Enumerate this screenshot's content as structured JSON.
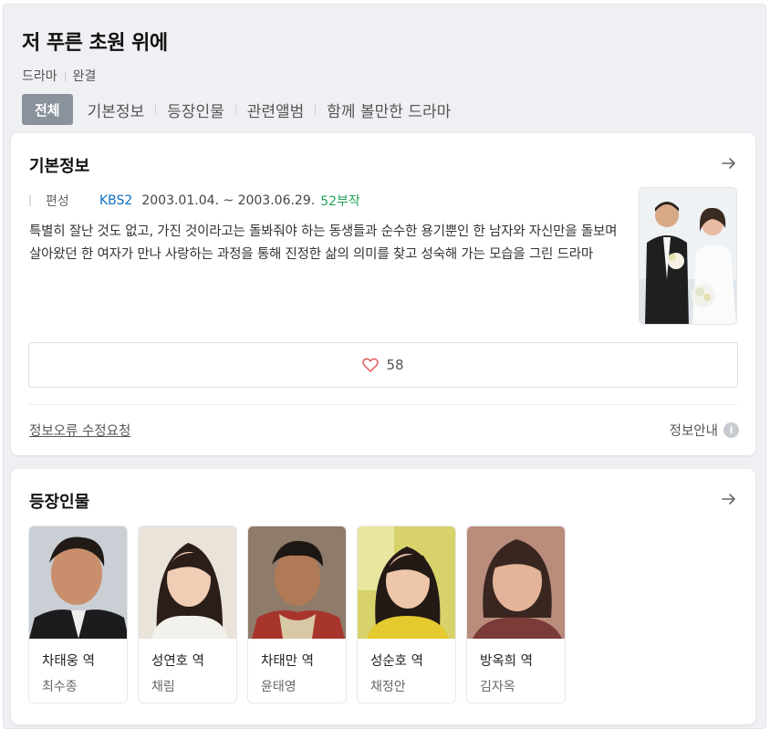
{
  "header": {
    "title": "저 푸른 초원 위에",
    "genre": "드라마",
    "status": "완결"
  },
  "tabs": [
    {
      "label": "전체",
      "active": true
    },
    {
      "label": "기본정보",
      "active": false
    },
    {
      "label": "등장인물",
      "active": false
    },
    {
      "label": "관련앨범",
      "active": false
    },
    {
      "label": "함께 볼만한 드라마",
      "active": false
    }
  ],
  "basic_info": {
    "title": "기본정보",
    "label": "편성",
    "channel": "KBS2",
    "date_range": "2003.01.04. ~ 2003.06.29.",
    "episodes": "52부작",
    "description": "특별히 잘난 것도 없고, 가진 것이라고는 돌봐줘야 하는 동생들과 순수한 용기뿐인 한 남자와 자신만을 돌보며 살아왔던 한 여자가 만나 사랑하는 과정을 통해 진정한 삶의 의미를 찾고 성숙해 가는 모습을 그린 드라마",
    "likes": "58",
    "report_link": "정보오류 수정요청",
    "info_guide": "정보안내",
    "info_icon_glyph": "i"
  },
  "cast": {
    "title": "등장인물",
    "members": [
      {
        "role": "차태웅 역",
        "actor": "최수종"
      },
      {
        "role": "성연호 역",
        "actor": "채림"
      },
      {
        "role": "차태만 역",
        "actor": "윤태영"
      },
      {
        "role": "성순호 역",
        "actor": "채정안"
      },
      {
        "role": "방옥희 역",
        "actor": "김자옥"
      }
    ]
  },
  "colors": {
    "accent_channel": "#0e6fc1",
    "accent_episodes": "#23a35a",
    "active_tab_bg": "#8a929c",
    "heart": "#e35b5b"
  }
}
